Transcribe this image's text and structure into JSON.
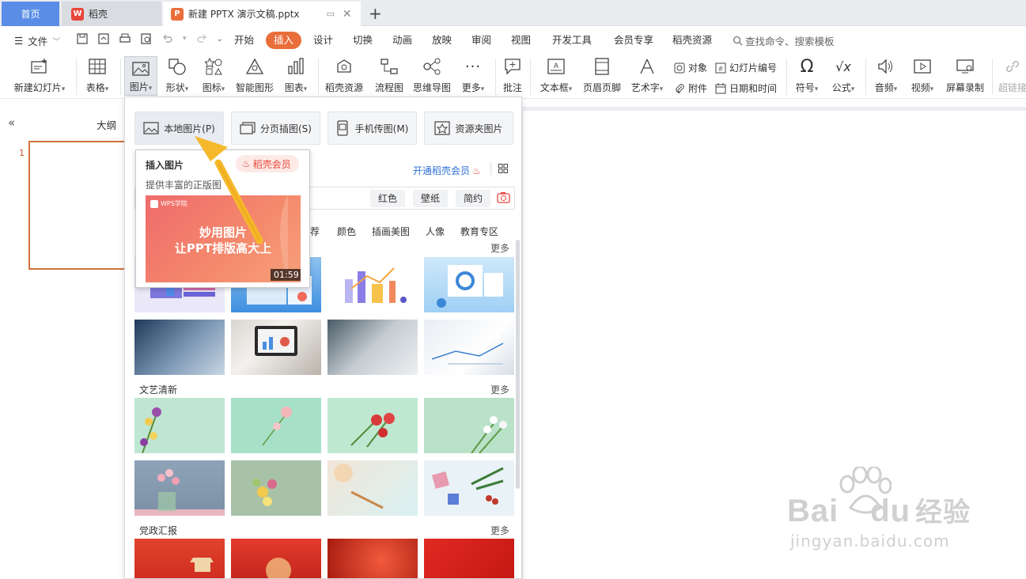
{
  "tabs": {
    "home": "首页",
    "daoke": "稻壳",
    "doc": "新建 PPTX 演示文稿.pptx",
    "new_tab": "+"
  },
  "menu": {
    "file": "文件",
    "tabs": [
      "开始",
      "插入",
      "设计",
      "切换",
      "动画",
      "放映",
      "审阅",
      "视图",
      "开发工具",
      "会员专享",
      "稻壳资源"
    ],
    "active_tab": "插入",
    "search": "查找命令、搜索模板"
  },
  "ribbon": {
    "new_slide": "新建幻灯片",
    "table": "表格",
    "picture": "图片",
    "shape": "形状",
    "icon": "图标",
    "smart_shape": "智能图形",
    "chart": "图表",
    "daoke_res": "稻壳资源",
    "flowchart": "流程图",
    "mindmap": "思维导图",
    "more": "更多",
    "comment": "批注",
    "textbox": "文本框",
    "header_footer": "页眉页脚",
    "wordart": "艺术字",
    "object": "对象",
    "slide_number": "幻灯片编号",
    "attachment": "附件",
    "datetime": "日期和时间",
    "symbol": "符号",
    "formula": "公式",
    "audio": "音频",
    "video": "视频",
    "screen_record": "屏幕录制",
    "hyperlink": "超链接"
  },
  "left_pane": {
    "outline": "大纲",
    "collapse": "«",
    "slide_number": "1"
  },
  "dropdown": {
    "buttons": [
      "本地图片(P)",
      "分页插图(S)",
      "手机传图(M)",
      "资源夹图片"
    ],
    "open_member": "开通稻壳会员",
    "chips": [
      "红色",
      "壁纸",
      "简约"
    ],
    "categories": [
      "荐",
      "颜色",
      "插画美图",
      "人像",
      "教育专区"
    ],
    "sections": [
      "文艺清新",
      "党政汇报"
    ],
    "more": "更多"
  },
  "tooltip": {
    "title": "插入图片",
    "badge": "稻壳会员",
    "desc": "提供丰富的正版图",
    "video_brand": "WPS学院",
    "video_line1": "妙用图片",
    "video_line2": "让PPT排版高大上",
    "duration": "01:59"
  },
  "watermark": {
    "brand": "Bai",
    "brand2": "du",
    "cn": "经验",
    "url": "jingyan.baidu.com"
  },
  "colors": {
    "accent": "#e96e3a",
    "home_tab": "#5a8de6",
    "daoke_red": "#e8463a",
    "arrow": "#f5b82a",
    "link_blue": "#2f6fd8"
  }
}
